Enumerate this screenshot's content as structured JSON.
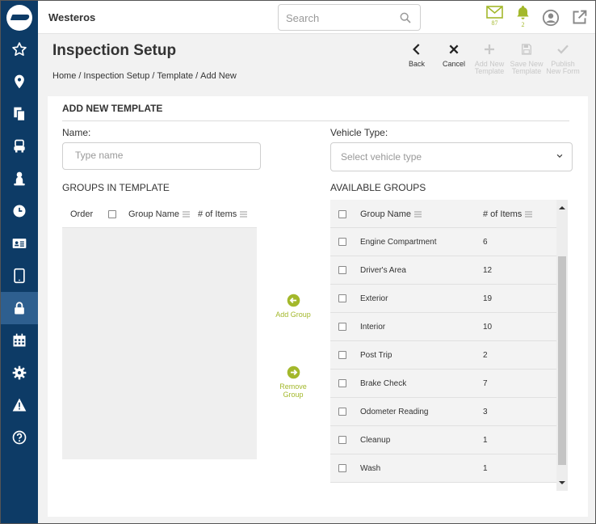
{
  "app": {
    "name": "Westeros"
  },
  "search": {
    "placeholder": "Search"
  },
  "topbar": {
    "mail_count": "87",
    "alerts_count": "2"
  },
  "colors": {
    "sidebar": "#0d3b66",
    "sidebar_active": "#2e5f8f",
    "accent": "#a3b82b"
  },
  "sidebar": {
    "items": [
      {
        "icon": "star-icon",
        "name": "favorites"
      },
      {
        "icon": "map-pin-icon",
        "name": "locations"
      },
      {
        "icon": "documents-icon",
        "name": "documents"
      },
      {
        "icon": "vehicle-icon",
        "name": "vehicles"
      },
      {
        "icon": "driver-icon",
        "name": "drivers"
      },
      {
        "icon": "clock-icon",
        "name": "history"
      },
      {
        "icon": "id-card-icon",
        "name": "id-cards"
      },
      {
        "icon": "tablet-icon",
        "name": "devices"
      },
      {
        "icon": "lock-icon",
        "name": "security",
        "active": true
      },
      {
        "icon": "calendar-icon",
        "name": "calendar"
      },
      {
        "icon": "gear-icon",
        "name": "settings"
      },
      {
        "icon": "warning-icon",
        "name": "alerts"
      },
      {
        "icon": "help-icon",
        "name": "help"
      }
    ]
  },
  "page": {
    "title": "Inspection Setup",
    "breadcrumb": [
      "Home",
      "/",
      "Inspection Setup",
      "/",
      "Template",
      "/",
      "Add New"
    ]
  },
  "actions": {
    "back": "Back",
    "cancel": "Cancel",
    "add_new_template": "Add New Template",
    "save_new_template": "Save New Template",
    "publish_new_form": "Publish New Form"
  },
  "form": {
    "section_title": "ADD NEW TEMPLATE",
    "name_label": "Name:",
    "name_placeholder": "Type name",
    "vehicle_type_label": "Vehicle Type:",
    "vehicle_type_placeholder": "Select vehicle type",
    "groups_in_template_label": "GROUPS IN TEMPLATE",
    "available_groups_label": "AVAILABLE GROUPS"
  },
  "template_table": {
    "columns": [
      "Order",
      "Group Name",
      "# of Items"
    ]
  },
  "move_buttons": {
    "add": "Add Group",
    "remove": "Remove Group"
  },
  "available_table": {
    "columns": [
      "Group Name",
      "# of Items"
    ],
    "rows": [
      {
        "name": "Engine Compartment",
        "items": "6"
      },
      {
        "name": "Driver's Area",
        "items": "12"
      },
      {
        "name": "Exterior",
        "items": "19"
      },
      {
        "name": "Interior",
        "items": "10"
      },
      {
        "name": "Post Trip",
        "items": "2"
      },
      {
        "name": "Brake Check",
        "items": "7"
      },
      {
        "name": "Odometer Reading",
        "items": "3"
      },
      {
        "name": "Cleanup",
        "items": "1"
      },
      {
        "name": "Wash",
        "items": "1"
      }
    ]
  }
}
